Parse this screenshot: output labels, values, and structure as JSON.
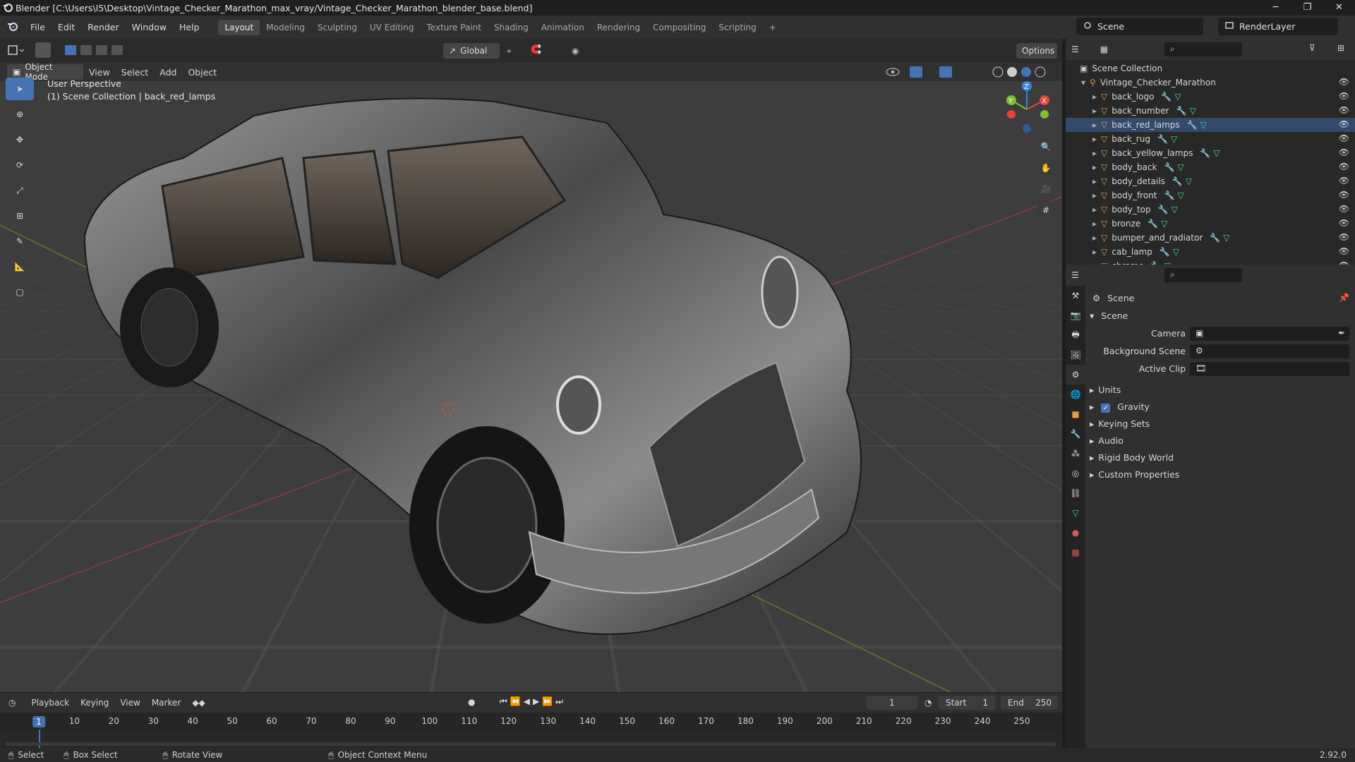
{
  "window": {
    "title": "Blender [C:\\Users\\I5\\Desktop\\Vintage_Checker_Marathon_max_vray/Vintage_Checker_Marathon_blender_base.blend]",
    "minimize": "─",
    "maximize": "❐",
    "close": "✕"
  },
  "menu": [
    "File",
    "Edit",
    "Render",
    "Window",
    "Help"
  ],
  "workspaces": [
    "Layout",
    "Modeling",
    "Sculpting",
    "UV Editing",
    "Texture Paint",
    "Shading",
    "Animation",
    "Rendering",
    "Compositing",
    "Scripting"
  ],
  "workspace_add": "+",
  "scene_name": "Scene",
  "view_layer": "RenderLayer",
  "toolheader": {
    "orientation": "Global",
    "options": "Options"
  },
  "viewport_header": {
    "mode": "Object Mode",
    "menus": [
      "View",
      "Select",
      "Add",
      "Object"
    ]
  },
  "viewport_info": {
    "line1": "User Perspective",
    "line2": "(1) Scene Collection | back_red_lamps"
  },
  "gizmo": {
    "x": "X",
    "y": "Y",
    "z": "Z"
  },
  "outliner": {
    "root": "Scene Collection",
    "collection": "Vintage_Checker_Marathon",
    "items": [
      "back_logo",
      "back_number",
      "back_red_lamps",
      "back_rug",
      "back_yellow_lamps",
      "body_back",
      "body_details",
      "body_front",
      "body_top",
      "bronze",
      "bumper_and_radiator",
      "cab_lamp",
      "chrome"
    ],
    "selected": "back_red_lamps"
  },
  "properties": {
    "header": "Scene",
    "panel": "Scene",
    "camera_label": "Camera",
    "background_label": "Background Scene",
    "clip_label": "Active Clip",
    "sections": [
      "Units",
      "Gravity",
      "Keying Sets",
      "Audio",
      "Rigid Body World",
      "Custom Properties"
    ],
    "gravity_checked": true
  },
  "timeline": {
    "menus": [
      "Playback",
      "Keying",
      "View",
      "Marker"
    ],
    "current_frame": "1",
    "start_label": "Start",
    "start": "1",
    "end_label": "End",
    "end": "250",
    "ticks": [
      "1",
      "10",
      "20",
      "30",
      "40",
      "50",
      "60",
      "70",
      "80",
      "90",
      "100",
      "110",
      "120",
      "130",
      "140",
      "150",
      "160",
      "170",
      "180",
      "190",
      "200",
      "210",
      "220",
      "230",
      "240",
      "250"
    ]
  },
  "statusbar": {
    "select": "Select",
    "box_select": "Box Select",
    "rotate": "Rotate View",
    "context": "Object Context Menu",
    "version": "2.92.0"
  },
  "colors": {
    "accent": "#4772b3",
    "object_orange": "#e39b4c",
    "mesh_green": "#4dd6a8",
    "x_axis": "#e3433f",
    "y_axis": "#7fbd3a",
    "z_axis": "#3a84e3"
  }
}
